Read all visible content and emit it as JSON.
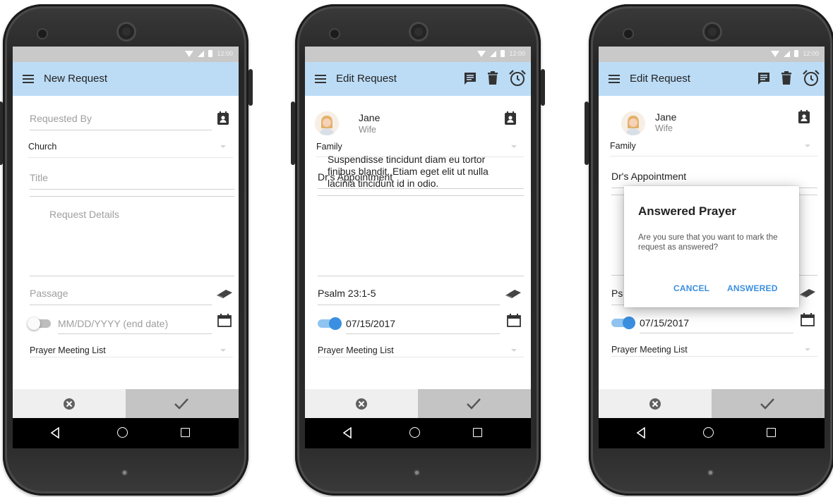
{
  "screens": [
    {
      "title": "New Request",
      "requested_by_placeholder": "Requested By",
      "category": "Church",
      "title_placeholder": "Title",
      "details_placeholder": "Request Details",
      "passage_placeholder": "Passage",
      "date_placeholder": "MM/DD/YYYY (end date)",
      "list": "Prayer Meeting List"
    },
    {
      "title": "Edit Request",
      "person_name": "Jane",
      "person_relation": "Wife",
      "category": "Family",
      "request_title": "Dr's Appointment",
      "details": "Suspendisse tincidunt diam eu tortor finibus blandit. Etiam eget elit ut nulla lacinia tincidunt id in odio.",
      "passage": "Psalm 23:1-5",
      "date": "07/15/2017",
      "list": "Prayer Meeting List"
    },
    {
      "title": "Edit Request",
      "person_name": "Jane",
      "person_relation": "Wife",
      "category": "Family",
      "request_title": "Dr's Appointment",
      "passage_partial": "Ps",
      "date": "07/15/2017",
      "list": "Prayer Meeting List"
    }
  ],
  "dialog": {
    "title": "Answered Prayer",
    "body": "Are you sure that you want to mark the request as answered?",
    "cancel": "CANCEL",
    "confirm": "ANSWERED"
  },
  "colors": {
    "appbar": "#bcdcf6",
    "accent": "#3b8fe0",
    "statusbar": "#c9c9c9"
  },
  "icons": [
    "menu-icon",
    "contact-card-icon",
    "book-icon",
    "calendar-icon",
    "comment-icon",
    "trash-icon",
    "alarm-icon",
    "cancel-icon",
    "check-icon"
  ]
}
